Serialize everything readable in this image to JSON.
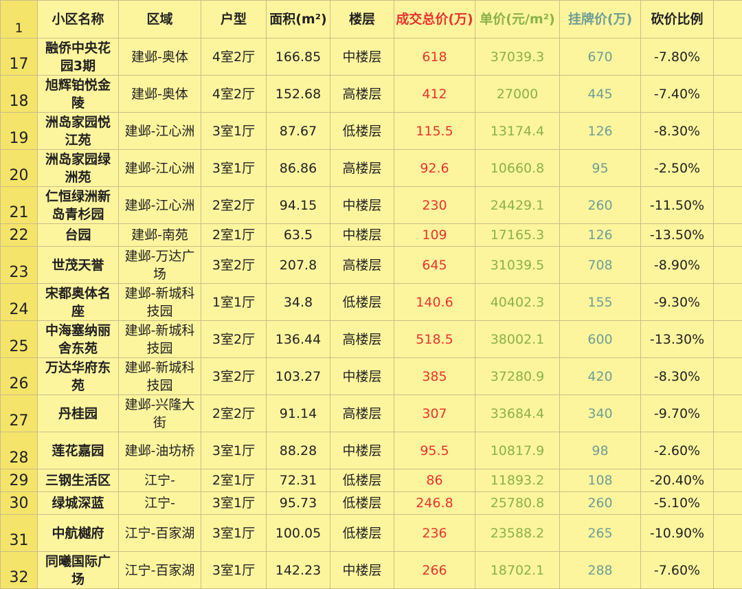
{
  "colors": {
    "background": "#fdf59e",
    "row_number_bg": "#f4e46a",
    "grid": "#c8bd86",
    "deal_price": "#e8332e",
    "unit_price": "#8ab14a",
    "list_price": "#6f9e94"
  },
  "header": {
    "row_number": "1",
    "name": "小区名称",
    "district": "区域",
    "layout": "户型",
    "area": "面积(m²)",
    "floor": "楼层",
    "deal_price": "成交总价(万)",
    "unit_price": "单价(元/m²)",
    "list_price": "挂牌价(万)",
    "discount": "砍价比例"
  },
  "rows": [
    {
      "n": "17",
      "name": "融侨中央花园3期",
      "district": "建邺-奥体",
      "layout": "4室2厅",
      "area": "166.85",
      "floor": "中楼层",
      "deal": "618",
      "unit": "37039.3",
      "list": "670",
      "discount": "-7.80%"
    },
    {
      "n": "18",
      "name": "旭辉铂悦金陵",
      "district": "建邺-奥体",
      "layout": "4室2厅",
      "area": "152.68",
      "floor": "高楼层",
      "deal": "412",
      "unit": "27000",
      "list": "445",
      "discount": "-7.40%"
    },
    {
      "n": "19",
      "name": "洲岛家园悦江苑",
      "district": "建邺-江心洲",
      "layout": "3室1厅",
      "area": "87.67",
      "floor": "低楼层",
      "deal": "115.5",
      "unit": "13174.4",
      "list": "126",
      "discount": "-8.30%"
    },
    {
      "n": "20",
      "name": "洲岛家园绿洲苑",
      "district": "建邺-江心洲",
      "layout": "3室1厅",
      "area": "86.86",
      "floor": "高楼层",
      "deal": "92.6",
      "unit": "10660.8",
      "list": "95",
      "discount": "-2.50%"
    },
    {
      "n": "21",
      "name": "仁恒绿洲新岛青杉园",
      "district": "建邺-江心洲",
      "layout": "2室2厅",
      "area": "94.15",
      "floor": "中楼层",
      "deal": "230",
      "unit": "24429.1",
      "list": "260",
      "discount": "-11.50%"
    },
    {
      "n": "22",
      "name": "台园",
      "district": "建邺-南苑",
      "layout": "2室1厅",
      "area": "63.5",
      "floor": "中楼层",
      "deal": "109",
      "unit": "17165.3",
      "list": "126",
      "discount": "-13.50%"
    },
    {
      "n": "23",
      "name": "世茂天誉",
      "district": "建邺-万达广场",
      "layout": "3室2厅",
      "area": "207.8",
      "floor": "高楼层",
      "deal": "645",
      "unit": "31039.5",
      "list": "708",
      "discount": "-8.90%"
    },
    {
      "n": "24",
      "name": "宋都奥体名座",
      "district": "建邺-新城科技园",
      "layout": "1室1厅",
      "area": "34.8",
      "floor": "低楼层",
      "deal": "140.6",
      "unit": "40402.3",
      "list": "155",
      "discount": "-9.30%"
    },
    {
      "n": "25",
      "name": "中海塞纳丽舍东苑",
      "district": "建邺-新城科技园",
      "layout": "3室2厅",
      "area": "136.44",
      "floor": "高楼层",
      "deal": "518.5",
      "unit": "38002.1",
      "list": "600",
      "discount": "-13.30%"
    },
    {
      "n": "26",
      "name": "万达华府东苑",
      "district": "建邺-新城科技园",
      "layout": "3室2厅",
      "area": "103.27",
      "floor": "中楼层",
      "deal": "385",
      "unit": "37280.9",
      "list": "420",
      "discount": "-8.30%"
    },
    {
      "n": "27",
      "name": "丹桂园",
      "district": "建邺-兴隆大街",
      "layout": "2室2厅",
      "area": "91.14",
      "floor": "高楼层",
      "deal": "307",
      "unit": "33684.4",
      "list": "340",
      "discount": "-9.70%"
    },
    {
      "n": "28",
      "name": "莲花嘉园",
      "district": "建邺-油坊桥",
      "layout": "3室1厅",
      "area": "88.28",
      "floor": "中楼层",
      "deal": "95.5",
      "unit": "10817.9",
      "list": "98",
      "discount": "-2.60%"
    },
    {
      "n": "29",
      "name": "三钢生活区",
      "district": "江宁-",
      "layout": "2室1厅",
      "area": "72.31",
      "floor": "低楼层",
      "deal": "86",
      "unit": "11893.2",
      "list": "108",
      "discount": "-20.40%"
    },
    {
      "n": "30",
      "name": "绿城深蓝",
      "district": "江宁-",
      "layout": "3室1厅",
      "area": "95.73",
      "floor": "低楼层",
      "deal": "246.8",
      "unit": "25780.8",
      "list": "260",
      "discount": "-5.10%"
    },
    {
      "n": "31",
      "name": "中航樾府",
      "district": "江宁-百家湖",
      "layout": "3室1厅",
      "area": "100.05",
      "floor": "低楼层",
      "deal": "236",
      "unit": "23588.2",
      "list": "265",
      "discount": "-10.90%"
    },
    {
      "n": "32",
      "name": "同曦国际广场",
      "district": "江宁-百家湖",
      "layout": "3室1厅",
      "area": "142.23",
      "floor": "中楼层",
      "deal": "266",
      "unit": "18702.1",
      "list": "288",
      "discount": "-7.60%"
    }
  ]
}
